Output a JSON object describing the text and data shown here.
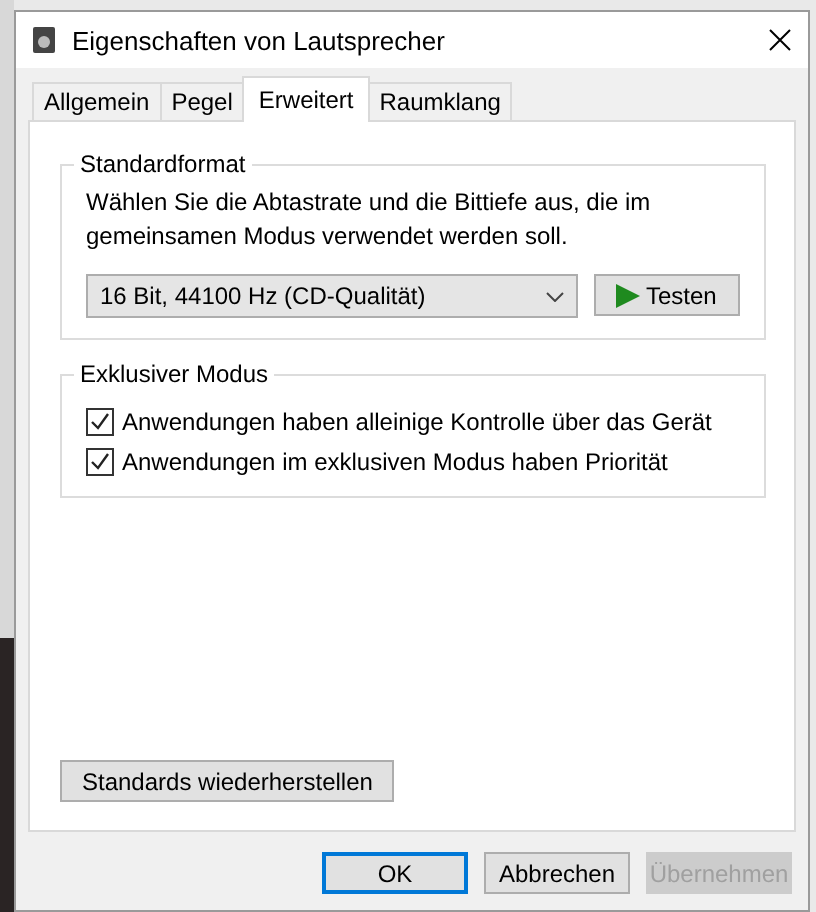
{
  "window": {
    "title": "Eigenschaften von Lautsprecher"
  },
  "tabs": [
    {
      "label": "Allgemein",
      "selected": false
    },
    {
      "label": "Pegel",
      "selected": false
    },
    {
      "label": "Erweitert",
      "selected": true
    },
    {
      "label": "Raumklang",
      "selected": false
    }
  ],
  "default_format": {
    "title": "Standardformat",
    "description": "Wählen Sie die Abtastrate und die Bittiefe aus, die im gemeinsamen Modus verwendet werden soll.",
    "format": "16 Bit, 44100 Hz (CD-Qualität)",
    "test_button": "Testen"
  },
  "exclusive_mode": {
    "title": "Exklusiver Modus",
    "options": [
      {
        "label": "Anwendungen haben alleinige Kontrolle über das Gerät",
        "checked": true
      },
      {
        "label": "Anwendungen im exklusiven Modus haben Priorität",
        "checked": true
      }
    ]
  },
  "restore_button": "Standards wiederherstellen",
  "buttons": [
    {
      "label": "OK",
      "kind": "default",
      "disabled": false
    },
    {
      "label": "Abbrechen",
      "kind": "normal",
      "disabled": false
    },
    {
      "label": "Übernehmen",
      "kind": "normal",
      "disabled": true
    }
  ]
}
